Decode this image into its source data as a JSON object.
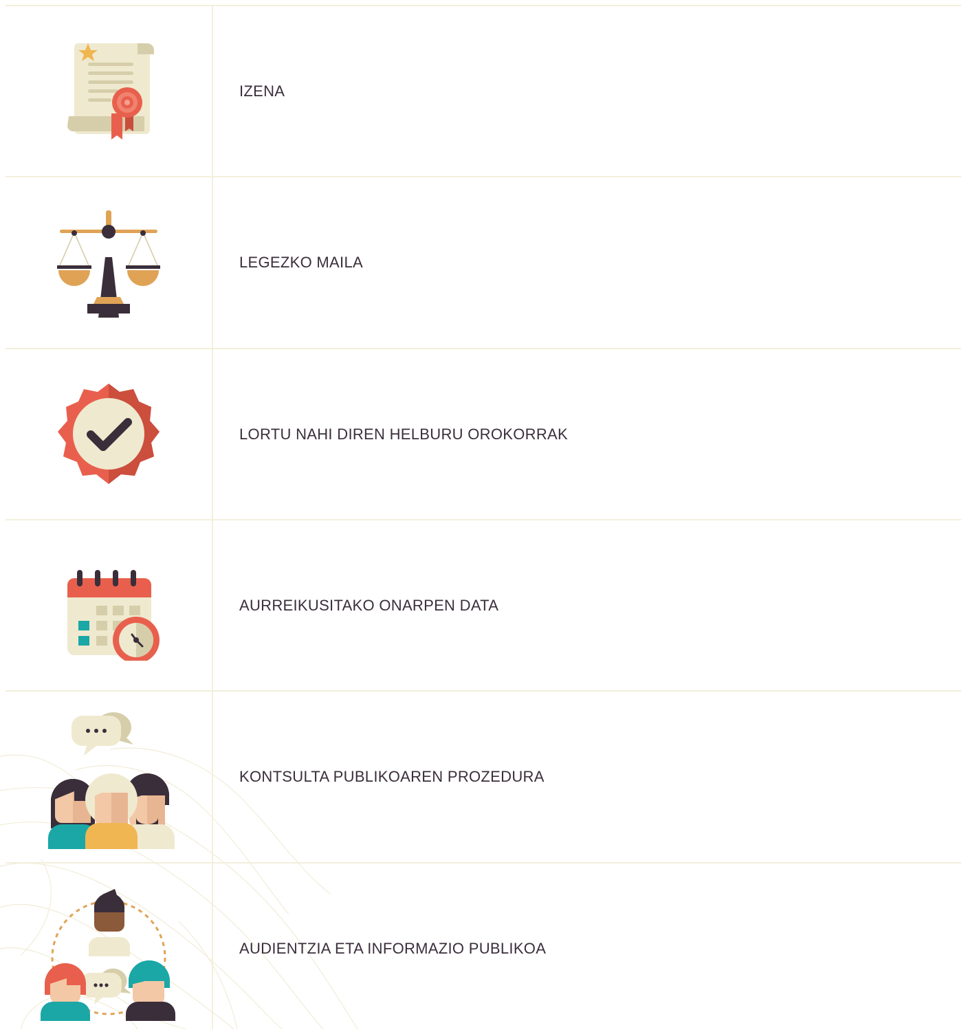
{
  "rows": [
    {
      "label": "IZENA",
      "icon": "certificate-scroll-icon"
    },
    {
      "label": "LEGEZKO MAILA",
      "icon": "scales-of-justice-icon"
    },
    {
      "label": "LORTU NAHI DIREN HELBURU OROKORRAK",
      "icon": "check-badge-icon"
    },
    {
      "label": "AURREIKUSITAKO ONARPEN DATA",
      "icon": "calendar-clock-icon"
    },
    {
      "label": "KONTSULTA PUBLIKOAREN PROZEDURA",
      "icon": "group-chat-icon"
    },
    {
      "label": "AUDIENTZIA ETA INFORMAZIO PUBLIKOA",
      "icon": "people-circle-icon"
    }
  ],
  "colors": {
    "grid_line": "#f3efdc",
    "text": "#3a2e3a",
    "cream": "#efe9cf",
    "red": "#e8604d",
    "dark": "#3a2e3a",
    "gold": "#e0a356",
    "teal": "#1aa7a6"
  }
}
